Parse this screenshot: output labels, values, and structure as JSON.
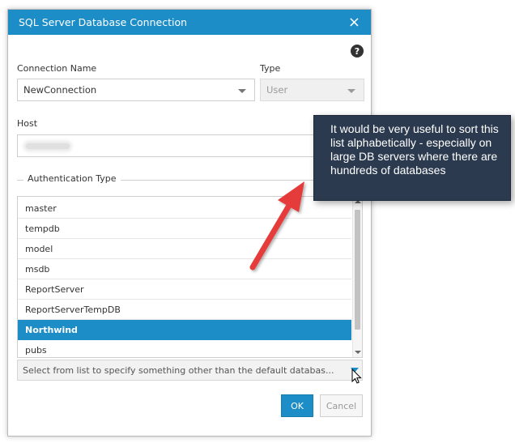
{
  "dialog": {
    "title": "SQL Server Database Connection",
    "close_label": "×",
    "help_label": "?"
  },
  "form": {
    "connection_name_label": "Connection Name",
    "connection_name_value": "NewConnection",
    "type_label": "Type",
    "type_value": "User",
    "host_label": "Host",
    "auth_type_label": "Authentication Type"
  },
  "database_list": {
    "items": [
      "master",
      "tempdb",
      "model",
      "msdb",
      "ReportServer",
      "ReportServerTempDB",
      "Northwind",
      "pubs"
    ],
    "selected": "Northwind"
  },
  "database_selector": {
    "placeholder": "Select from list to specify something other than the default databas..."
  },
  "buttons": {
    "ok_label": "OK",
    "cancel_label": "Cancel"
  },
  "annotation": {
    "text": "It would be very useful to sort this list alphabetically - especially on large DB servers where there are hundreds of databases"
  },
  "colors": {
    "accent": "#1c8dc7",
    "callout_bg": "#2b3a4e",
    "arrow": "#e63a3a"
  }
}
